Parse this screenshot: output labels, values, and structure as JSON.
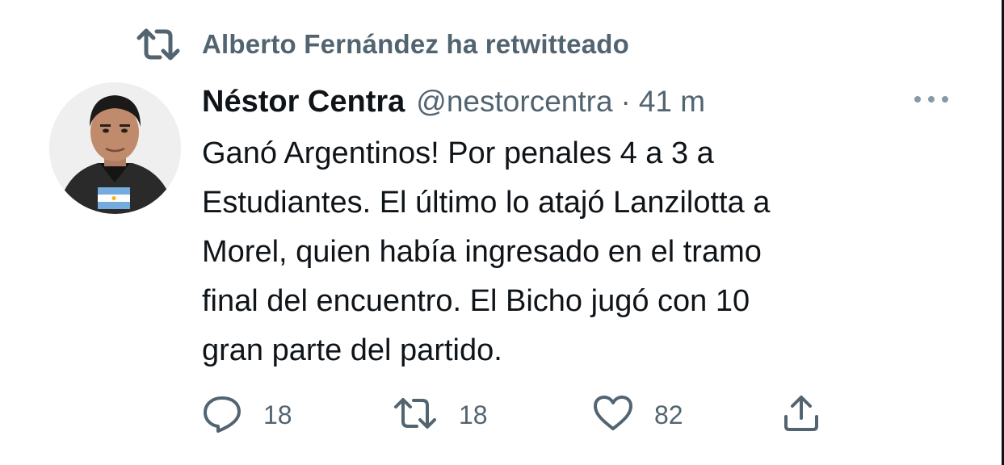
{
  "retweet_header": {
    "text": "Alberto Fernández ha retwitteado",
    "icon": "retweet-icon"
  },
  "tweet": {
    "author": {
      "display_name": "Néstor Centra",
      "handle": "@nestorcentra",
      "avatar": "avatar-photo-with-argentina-flag"
    },
    "separator": "·",
    "time": "41 m",
    "text_lines": [
      "Ganó Argentinos! Por penales 4 a 3 a",
      "Estudiantes. El último lo atajó Lanzilotta a",
      "Morel, quien había ingresado en el tramo",
      "final del encuentro. El Bicho jugó con 10",
      "gran parte del partido."
    ],
    "actions": {
      "reply": {
        "icon": "reply-icon",
        "count": "18"
      },
      "retweet": {
        "icon": "retweet-icon",
        "count": "18"
      },
      "like": {
        "icon": "heart-icon",
        "count": "82"
      },
      "share": {
        "icon": "share-icon"
      }
    },
    "more_icon": "more-options-icon"
  },
  "colors": {
    "text_primary": "#0f1419",
    "text_secondary": "#536471",
    "background": "#ffffff",
    "flag_blue": "#74acdf"
  }
}
